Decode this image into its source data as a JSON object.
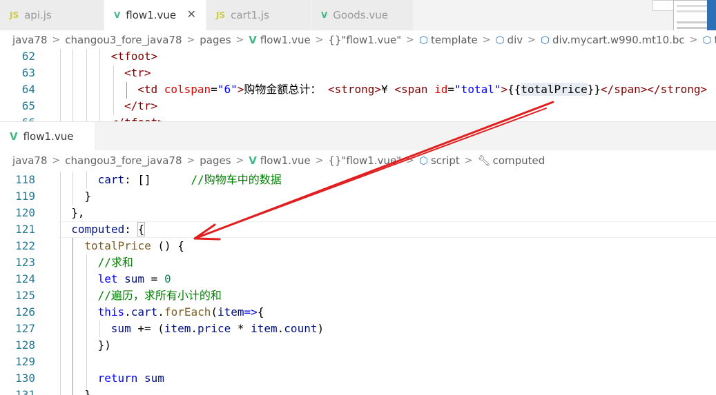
{
  "top_tabs": [
    {
      "icon": "JS",
      "label": "api.js",
      "active": false
    },
    {
      "icon": "V",
      "label": "flow1.vue",
      "active": true,
      "close": "✕"
    },
    {
      "icon": "JS",
      "label": "cart1.js",
      "active": false
    },
    {
      "icon": "V",
      "label": "Goods.vue",
      "active": false
    }
  ],
  "top_breadcrumb": {
    "items": [
      "java78",
      "changou3_fore_java78",
      "pages",
      "flow1.vue",
      "\"flow1.vue\"",
      "template",
      "div",
      "div.mycart.w990.mt10.bc",
      "table"
    ],
    "braces": "{}"
  },
  "top_lines": [
    {
      "num": "62",
      "html": "<span class=\"t-tag\">&lt;tfoot&gt;</span>"
    },
    {
      "num": "63",
      "html": "<span class=\"t-tag\">&lt;tr&gt;</span>"
    },
    {
      "num": "64",
      "html": "<span class=\"t-tag\">&lt;td</span> <span class=\"t-attr\">colspan</span>=<span class=\"t-str\">\"6\"</span><span class=\"t-tag\">&gt;</span>购物金额总计： <span class=\"t-tag\">&lt;strong&gt;</span>¥ <span class=\"t-tag\">&lt;span</span> <span class=\"t-attr\">id</span>=<span class=\"t-str\">\"total\"</span><span class=\"t-tag\">&gt;</span>{{<span class=\"hl\">totalPrice</span>}}<span class=\"t-tag\">&lt;/span&gt;&lt;/strong&gt;</span>"
    },
    {
      "num": "65",
      "html": "<span class=\"t-tag\">&lt;/tr&gt;</span>"
    },
    {
      "num": "66",
      "html": "<span class=\"t-tag\">&lt;/tfoot&gt;</span>"
    }
  ],
  "bottom_tab": {
    "icon": "V",
    "label": "flow1.vue"
  },
  "bottom_breadcrumb": {
    "items": [
      "java78",
      "changou3_fore_java78",
      "pages",
      "flow1.vue",
      "\"flow1.vue\"",
      "script",
      "computed"
    ],
    "braces": "{}"
  },
  "bottom_lines": [
    {
      "num": "118",
      "html": "<span class=\"t-var\">cart</span>: []      <span class=\"t-com\">//购物车中的数据</span>"
    },
    {
      "num": "119",
      "html": "}"
    },
    {
      "num": "120",
      "html": "},"
    },
    {
      "num": "121",
      "html": "<span class=\"t-var\">computed</span>: <span class=\"bm\">{</span>"
    },
    {
      "num": "122",
      "html": "<span class=\"t-fn\">totalPrice</span> () {"
    },
    {
      "num": "123",
      "html": "<span class=\"t-com\">//求和</span>"
    },
    {
      "num": "124",
      "html": "<span class=\"t-kw\">let</span> <span class=\"t-var\">sum</span> = <span class=\"t-num\">0</span>"
    },
    {
      "num": "125",
      "html": "<span class=\"t-com\">//遍历，求所有小计的和</span>"
    },
    {
      "num": "126",
      "html": "<span class=\"t-kw\">this</span>.<span class=\"t-var\">cart</span>.<span class=\"t-fn\">forEach</span>(<span class=\"t-var\">item</span><span class=\"t-kw\">=&gt;</span>{"
    },
    {
      "num": "127",
      "html": "<span class=\"t-var\">sum</span> += (<span class=\"t-var\">item</span>.<span class=\"t-var\">price</span> * <span class=\"t-var\">item</span>.<span class=\"t-var\">count</span>)"
    },
    {
      "num": "128",
      "html": "})"
    },
    {
      "num": "129",
      "html": ""
    },
    {
      "num": "130",
      "html": "<span class=\"t-kw\">return</span> <span class=\"t-var\">sum</span>"
    },
    {
      "num": "131",
      "html": "}"
    }
  ],
  "colors": {
    "annotation_arrow": "#e02020",
    "vue_icon": "#41b883",
    "js_icon": "#cbcb41",
    "line_number": "#237893"
  }
}
